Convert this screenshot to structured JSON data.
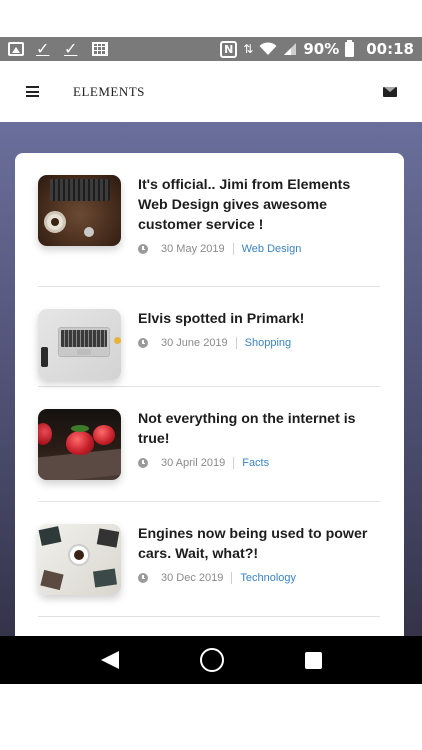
{
  "status_bar": {
    "battery": "90%",
    "time": "00:18",
    "left_icons": [
      "image-icon",
      "check-download-icon",
      "check-download-icon",
      "grid-icon"
    ],
    "right_icons": [
      "nfc-icon",
      "data-arrows-icon",
      "wifi-icon",
      "signal-icon",
      "battery-icon"
    ]
  },
  "app_bar": {
    "brand": "ELEMENTS",
    "menu_icon": "menu-icon",
    "mail_icon": "mail-icon"
  },
  "posts": [
    {
      "title": "It's official.. Jimi from Elements Web Design gives awesome customer service !",
      "date": "30 May 2019",
      "category": "Web Design",
      "thumbnail": "keyboard-desk-image"
    },
    {
      "title": "Elvis spotted in Primark!",
      "date": "30 June 2019",
      "category": "Shopping",
      "thumbnail": "laptop-image"
    },
    {
      "title": "Not everything on the internet is true!",
      "date": "30 April 2019",
      "category": "Facts",
      "thumbnail": "strawberries-image"
    },
    {
      "title": "Engines now being used to power cars. Wait, what?!",
      "date": "30 Dec 2019",
      "category": "Technology",
      "thumbnail": "coffee-photos-image"
    }
  ],
  "nav_bar": {
    "back": "back-icon",
    "home": "home-icon",
    "recent": "recent-apps-icon"
  },
  "colors": {
    "category_link": "#3a84c2",
    "background_top": "#6a6f9b",
    "background_bottom": "#34334a"
  }
}
